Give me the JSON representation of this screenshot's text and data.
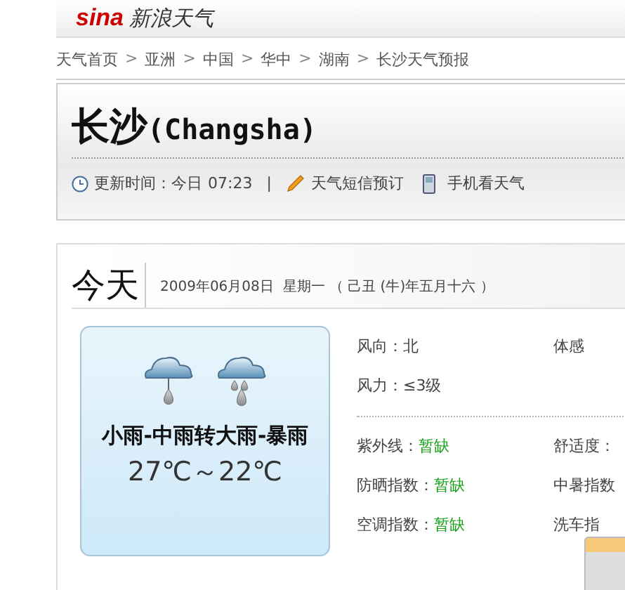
{
  "logo": {
    "brand": "sina",
    "title": "新浪天气"
  },
  "breadcrumb": [
    "天气首页",
    "亚洲",
    "中国",
    "华中",
    "湖南",
    "长沙天气预报"
  ],
  "breadcrumb_separator": ">",
  "city": {
    "name": "长沙",
    "latin": "(Changsha)"
  },
  "info": {
    "update_label": "更新时间：今日",
    "update_time": "07:23",
    "separator": "|",
    "sms": "天气短信预订",
    "mobile": "手机看天气"
  },
  "today": {
    "heading": "今天",
    "date": "2009年06月08日  星期一 （ 己丑 (牛)年五月十六 ）",
    "weather": "小雨-中雨转大雨-暴雨",
    "temps": "27℃～22℃",
    "wind": [
      {
        "left": "风向：北",
        "right": "体感"
      },
      {
        "left": "风力：≤3级"
      }
    ],
    "indices": [
      {
        "label": "紫外线：",
        "value": "暂缺",
        "right": "舒适度："
      },
      {
        "label": "防晒指数：",
        "value": "暂缺",
        "right": "中暑指数"
      },
      {
        "label": "空调指数：",
        "value": "暂缺",
        "right": "洗车指"
      }
    ]
  }
}
